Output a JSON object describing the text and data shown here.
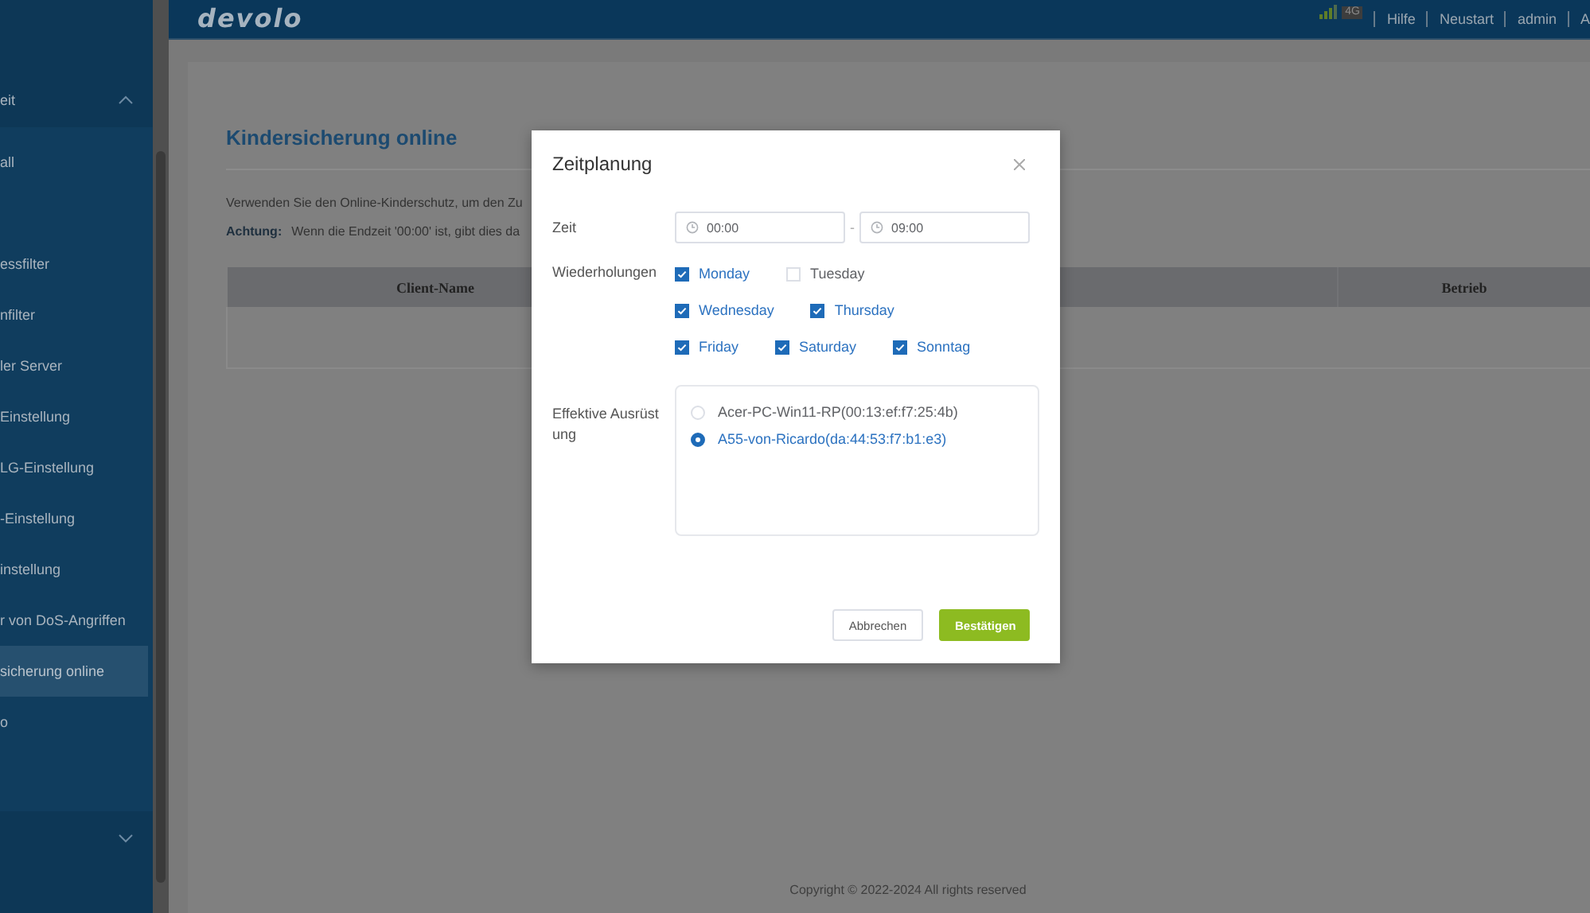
{
  "header": {
    "logo": "devolo",
    "network": "4G",
    "links": [
      "Hilfe",
      "Neustart",
      "admin",
      "A"
    ]
  },
  "sidebar": {
    "groups": [
      {
        "label": "eit",
        "expanded": true,
        "children": [
          {
            "label": "all",
            "selected": false
          },
          {
            "label": "essfilter",
            "selected": false
          },
          {
            "label": "nfilter",
            "selected": false
          },
          {
            "label": "ler Server",
            "selected": false
          },
          {
            "label": "Einstellung",
            "selected": false
          },
          {
            "label": "LG-Einstellung",
            "selected": false
          },
          {
            "label": "-Einstellung",
            "selected": false
          },
          {
            "label": "instellung",
            "selected": false
          },
          {
            "label": "r von DoS-Angriffen",
            "selected": false
          },
          {
            "label": "sicherung online",
            "selected": true
          },
          {
            "label": "o",
            "selected": false
          }
        ]
      },
      {
        "expanded": false
      }
    ]
  },
  "page": {
    "title": "Kindersicherung online",
    "intro": "Verwenden Sie den Online-Kinderschutz, um den Zu",
    "warning_label": "Achtung:",
    "warning": "Wenn die Endzeit '00:00' ist, gibt dies da",
    "table": {
      "columns": [
        "Client-Name",
        "Betrieb"
      ]
    },
    "footer": "Copyright © 2022-2024 All rights reserved"
  },
  "dialog": {
    "title": "Zeitplanung",
    "time_label": "Zeit",
    "start": "00:00",
    "separator": "-",
    "end": "09:00",
    "repeat_label": "Wiederholungen",
    "days": [
      [
        {
          "label": "Monday",
          "checked": true
        },
        {
          "label": "Tuesday",
          "checked": false
        }
      ],
      [
        {
          "label": "Wednesday",
          "checked": true
        },
        {
          "label": "Thursday",
          "checked": true
        }
      ],
      [
        {
          "label": "Friday",
          "checked": true
        },
        {
          "label": "Saturday",
          "checked": true
        },
        {
          "label": "Sonntag",
          "checked": true
        }
      ]
    ],
    "device_label": "Effektive Ausrüstung",
    "devices": [
      {
        "label": "Acer-PC-Win11-RP(00:13:ef:f7:25:4b)",
        "selected": false
      },
      {
        "label": "A55-von-Ricardo(da:44:53:f7:b1:e3)",
        "selected": true
      }
    ],
    "cancel": "Abbrechen",
    "confirm": "Bestätigen"
  }
}
